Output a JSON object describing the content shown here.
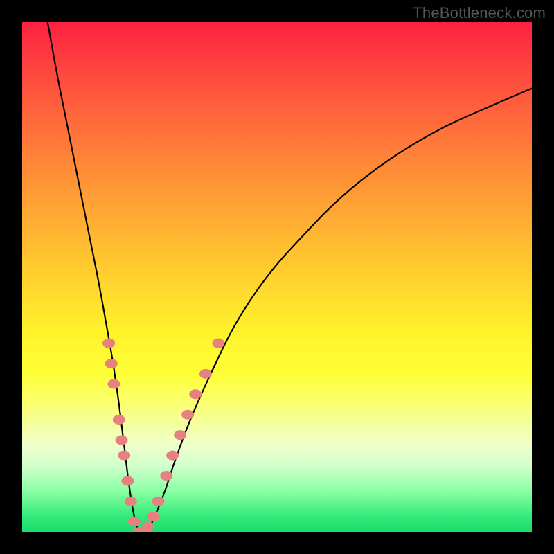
{
  "watermark": "TheBottleneck.com",
  "chart_data": {
    "type": "line",
    "title": "",
    "xlabel": "",
    "ylabel": "",
    "xlim": [
      0,
      100
    ],
    "ylim": [
      0,
      100
    ],
    "grid": false,
    "legend": false,
    "background": "gradient-red-yellow-green-vertical",
    "series": [
      {
        "name": "bottleneck-curve",
        "color": "#000000",
        "x": [
          5,
          7,
          9,
          11,
          13,
          15,
          17,
          18,
          19,
          20,
          21,
          22,
          23,
          24,
          25,
          26,
          28,
          30,
          33,
          37,
          42,
          48,
          55,
          63,
          72,
          82,
          93,
          100
        ],
        "y": [
          100,
          89,
          79,
          69,
          59,
          49,
          38,
          32,
          25,
          17,
          9,
          3,
          0,
          0,
          1,
          3,
          8,
          14,
          22,
          31,
          41,
          50,
          58,
          66,
          73,
          79,
          84,
          87
        ]
      }
    ],
    "markers": [
      {
        "name": "cluster-points",
        "color": "rgb(231,128,128)",
        "shape": "rounded-capsule",
        "points": [
          {
            "x": 17.0,
            "y": 37
          },
          {
            "x": 17.5,
            "y": 33
          },
          {
            "x": 18.0,
            "y": 29
          },
          {
            "x": 19.0,
            "y": 22
          },
          {
            "x": 19.5,
            "y": 18
          },
          {
            "x": 20.0,
            "y": 15
          },
          {
            "x": 20.7,
            "y": 10
          },
          {
            "x": 21.3,
            "y": 6
          },
          {
            "x": 22.0,
            "y": 2
          },
          {
            "x": 23.0,
            "y": 0
          },
          {
            "x": 24.0,
            "y": 0
          },
          {
            "x": 24.7,
            "y": 1
          },
          {
            "x": 25.7,
            "y": 3
          },
          {
            "x": 26.7,
            "y": 6
          },
          {
            "x": 28.3,
            "y": 11
          },
          {
            "x": 29.5,
            "y": 15
          },
          {
            "x": 31.0,
            "y": 19
          },
          {
            "x": 32.5,
            "y": 23
          },
          {
            "x": 34.0,
            "y": 27
          },
          {
            "x": 36.0,
            "y": 31
          },
          {
            "x": 38.5,
            "y": 37
          }
        ]
      }
    ]
  }
}
